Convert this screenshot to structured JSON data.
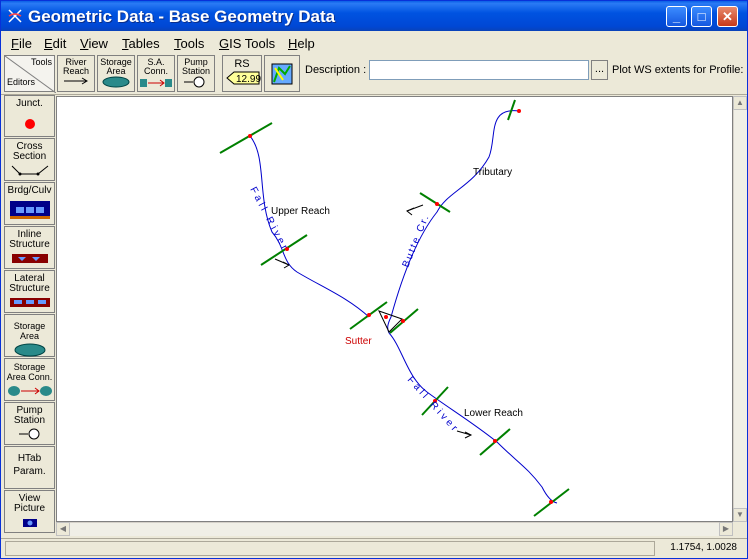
{
  "window": {
    "title": "Geometric Data - Base Geometry Data"
  },
  "title_buttons": {
    "minimize": "_",
    "maximize": "□",
    "close": "✕"
  },
  "menu": [
    {
      "label": "File",
      "key": "F"
    },
    {
      "label": "Edit",
      "key": "E"
    },
    {
      "label": "View",
      "key": "V"
    },
    {
      "label": "Tables",
      "key": "T"
    },
    {
      "label": "Tools",
      "key": "T"
    },
    {
      "label": "GIS Tools",
      "key": "G"
    },
    {
      "label": "Help",
      "key": "H"
    }
  ],
  "toolbar": {
    "tools_label": "Tools",
    "editors_label": "Editors",
    "river_reach": [
      "River",
      "Reach"
    ],
    "storage_area": [
      "Storage",
      "Area"
    ],
    "sa_conn": [
      "S.A.",
      "Conn."
    ],
    "pump_station": [
      "Pump",
      "Station"
    ],
    "rs_label": "RS",
    "rs_value": "12.99",
    "description_label": "Description :",
    "description_value": "",
    "ellipsis": "...",
    "plot_ws_label": "Plot WS extents for Profile:"
  },
  "sidebar": {
    "junct": "Junct.",
    "cross_section": [
      "Cross",
      "Section"
    ],
    "brdg_culv": "Brdg/Culv",
    "inline_structure": [
      "Inline",
      "Structure"
    ],
    "lateral_structure": [
      "Lateral",
      "Structure"
    ],
    "storage_area": [
      "Storage",
      "Area"
    ],
    "storage_area_conn": [
      "Storage",
      "Area Conn."
    ],
    "pump_station": [
      "Pump",
      "Station"
    ],
    "htab_param": [
      "HTab",
      "Param."
    ],
    "view_picture": [
      "View",
      "Picture"
    ]
  },
  "map": {
    "reach_labels": {
      "upper": "Upper Reach",
      "tributary": "Tributary",
      "lower": "Lower Reach"
    },
    "river_labels": {
      "fall_upper": "Fall River",
      "butte": "Butte Cr.",
      "fall_lower": "Fall River"
    },
    "junction_label": "Sutter",
    "colors": {
      "river_line": "#0000cc",
      "cross_section": "#008000",
      "node": "#ff0000",
      "junction_text": "#cc0000"
    }
  },
  "status": {
    "coordinates": "1.1754, 1.0028"
  }
}
